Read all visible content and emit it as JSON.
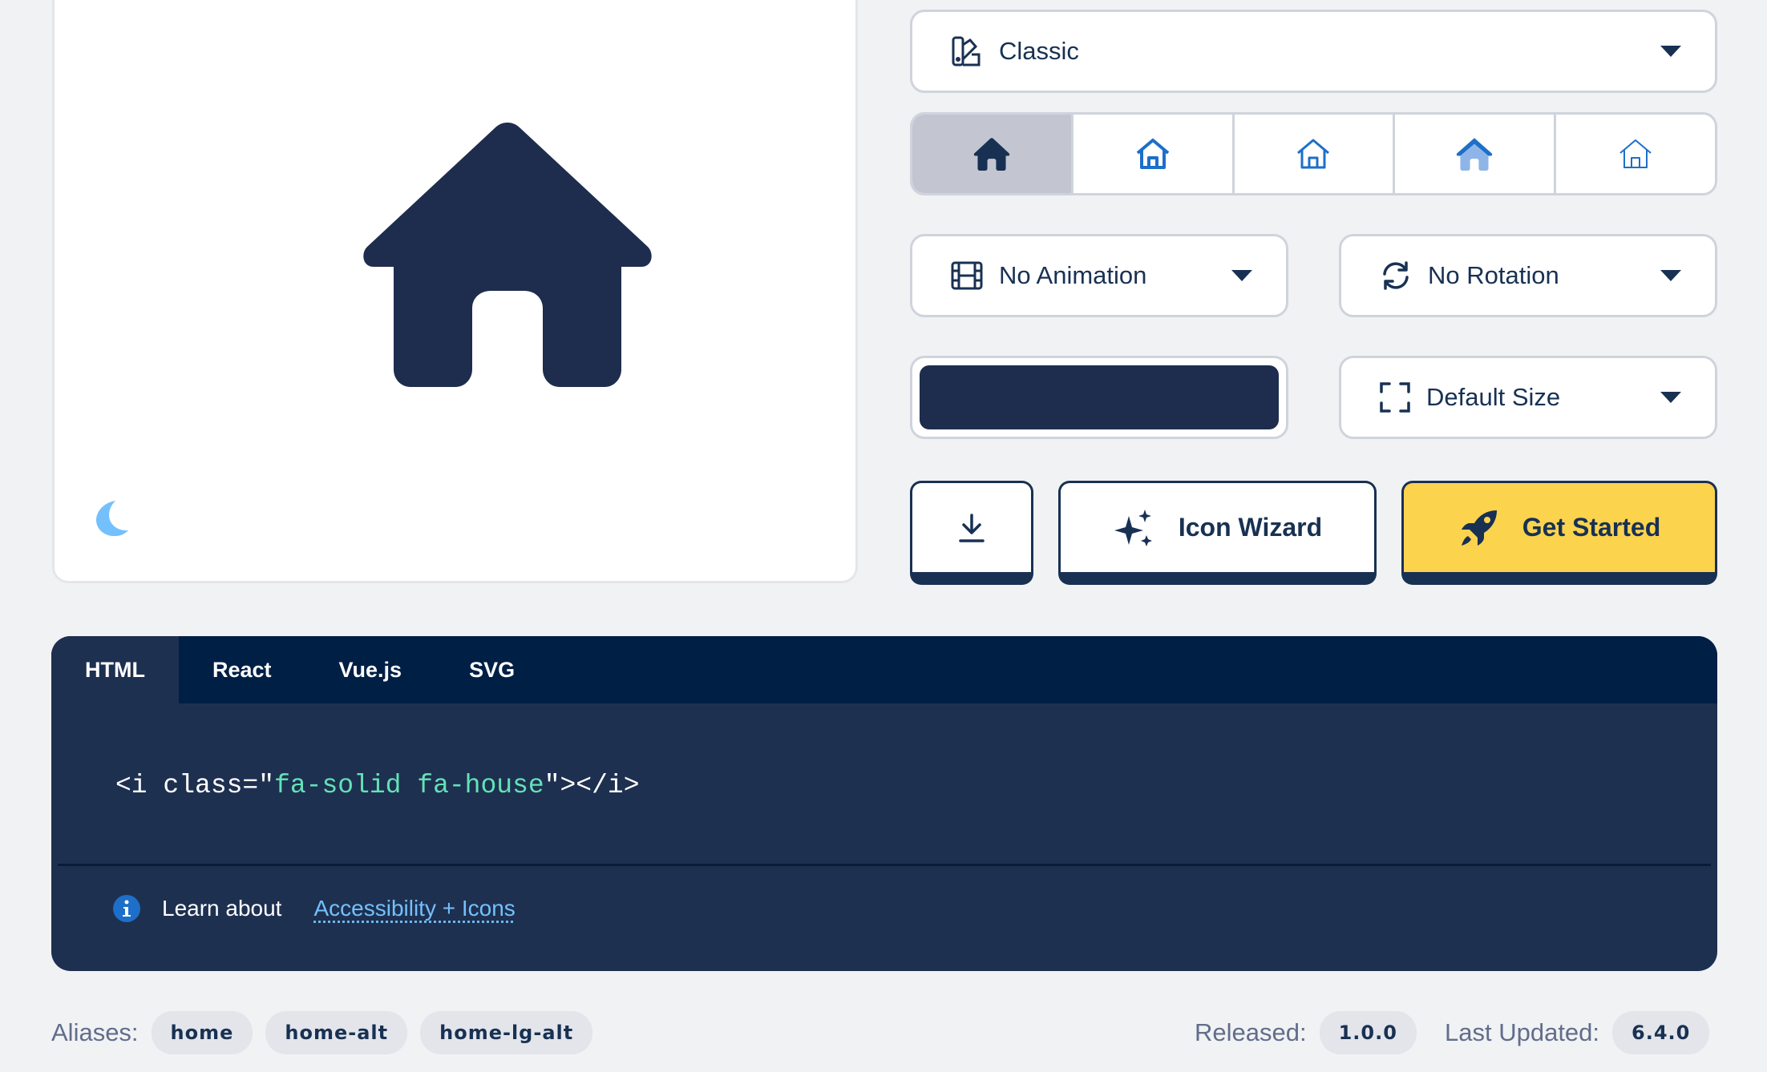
{
  "preview": {
    "icon": "house-icon",
    "theme_toggle_icon": "moon-icon"
  },
  "family_select": {
    "icon": "palette-icon",
    "value": "Classic"
  },
  "style_options": [
    {
      "name": "solid",
      "selected": true
    },
    {
      "name": "regular",
      "selected": false
    },
    {
      "name": "light",
      "selected": false
    },
    {
      "name": "duotone",
      "selected": false
    },
    {
      "name": "thin",
      "selected": false
    }
  ],
  "animation_select": {
    "icon": "film-icon",
    "value": "No Animation"
  },
  "rotation_select": {
    "icon": "rotate-icon",
    "value": "No Rotation"
  },
  "color": {
    "value": "#1e2d4d"
  },
  "size_select": {
    "icon": "expand-icon",
    "value": "Default Size"
  },
  "buttons": {
    "download": {
      "icon": "download-icon"
    },
    "wizard": {
      "icon": "sparkles-icon",
      "label": "Icon Wizard"
    },
    "get_started": {
      "icon": "rocket-icon",
      "label": "Get Started"
    }
  },
  "code_panel": {
    "tabs": [
      "HTML",
      "React",
      "Vue.js",
      "SVG"
    ],
    "active_tab": "HTML",
    "snippet_prefix": "<i class=\"",
    "snippet_value": "fa-solid fa-house",
    "snippet_suffix": "\"></i>",
    "learn_text": "Learn about",
    "link_text": "Accessibility + Icons"
  },
  "meta": {
    "aliases_label": "Aliases:",
    "aliases": [
      "home",
      "home-alt",
      "home-lg-alt"
    ],
    "released_label": "Released:",
    "released": "1.0.0",
    "updated_label": "Last Updated:",
    "updated": "6.4.0"
  },
  "colors": {
    "navy": "#183153",
    "accent_yellow": "#fcd34d",
    "code_bg": "#1e3050",
    "tab_bg": "#001f45",
    "code_value": "#63e2b7",
    "link": "#74c0fc"
  }
}
